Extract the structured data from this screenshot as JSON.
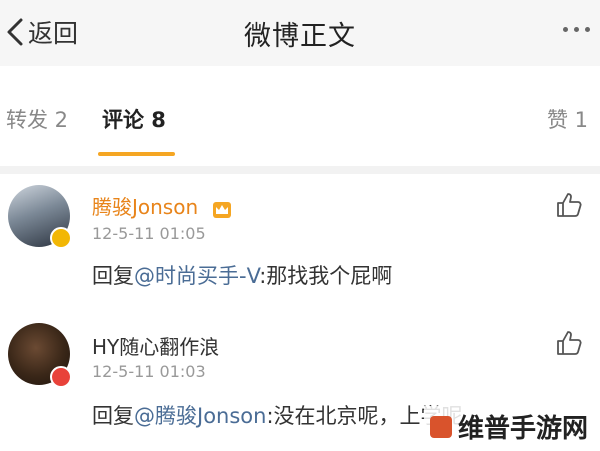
{
  "header": {
    "back_label": "返回",
    "title": "微博正文",
    "more_icon": "more-dots-icon"
  },
  "tabs": {
    "repost": "转发 2",
    "comment": "评论 8",
    "like": "赞 1",
    "active": "comment",
    "accent_color": "#f5a623"
  },
  "comments": [
    {
      "username": "腾骏Jonson",
      "username_color": "#e8841a",
      "badge": "vip-crown-icon",
      "time": "12-5-11 01:05",
      "text_prefix": "回复",
      "mention": "@时尚买手-V",
      "text_rest": ":那找我个屁啊",
      "like_icon": "thumbs-up-icon"
    },
    {
      "username": "HY随心翻作浪",
      "username_color": "#333333",
      "time": "12-5-11 01:03",
      "text_prefix": "回复",
      "mention": "@腾骏Jonson",
      "text_rest": ":没在北京呢，上学呢",
      "like_icon": "thumbs-up-icon"
    }
  ],
  "watermark": "维普手游网"
}
